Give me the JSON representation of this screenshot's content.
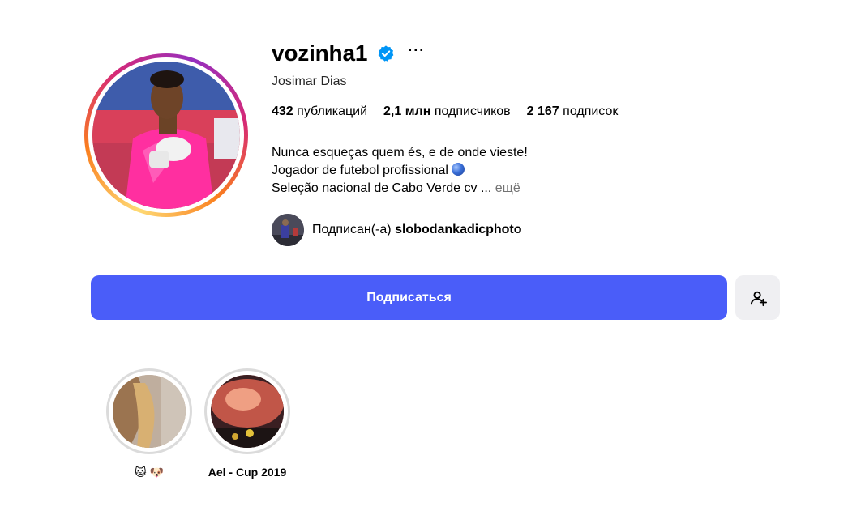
{
  "profile": {
    "username": "vozinha1",
    "verified_icon": "verified-badge-icon",
    "more_label": "···",
    "full_name": "Josimar Dias",
    "stats": {
      "posts_count": "432",
      "posts_label": "публикаций",
      "followers_count": "2,1 млн",
      "followers_label": "подписчиков",
      "following_count": "2 167",
      "following_label": "подписок"
    },
    "bio": {
      "line1": "Nunca esqueças quem és, e de onde vieste!",
      "line2": "Jogador de futebol profissional",
      "line2_emoji": "globe-icon",
      "line3": "Seleção nacional de Cabo Verde cv ...",
      "more_link": "ещё"
    },
    "followed_by": {
      "prefix": "Подписан(-а)",
      "account": "slobodankadicphoto"
    }
  },
  "actions": {
    "follow_label": "Подписаться",
    "add_user_icon": "add-user-icon"
  },
  "highlights": [
    {
      "label": "🐱 🐶"
    },
    {
      "label": "Ael - Cup 2019"
    }
  ],
  "colors": {
    "follow_button": "#4a5df9",
    "verified": "#0095f6",
    "secondary_button": "#efeff2"
  }
}
